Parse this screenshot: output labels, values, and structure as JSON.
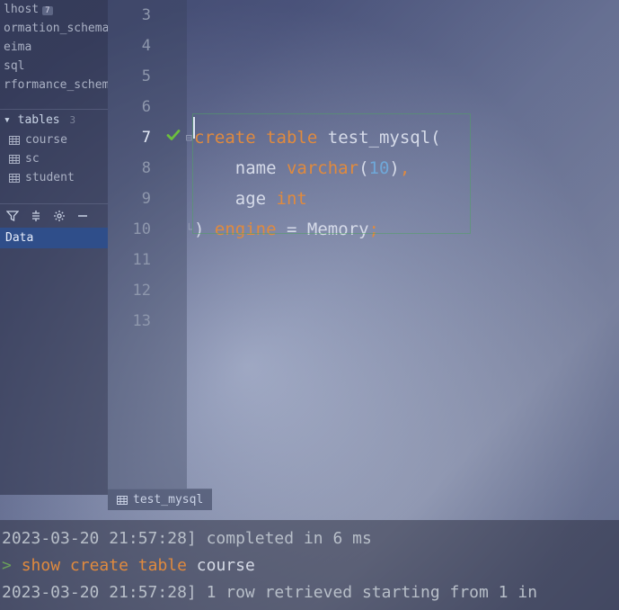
{
  "sidebar": {
    "databases": [
      {
        "name": "lhost",
        "badge": "7"
      },
      {
        "name": "ormation_schema",
        "badge": ""
      },
      {
        "name": "eima",
        "badge": ""
      },
      {
        "name": "sql",
        "badge": ""
      },
      {
        "name": "rformance_schem",
        "badge": ""
      }
    ],
    "tables_label": "tables",
    "tables_count": "3",
    "tables": [
      {
        "name": "course"
      },
      {
        "name": "sc"
      },
      {
        "name": "student"
      }
    ],
    "active_tab": "Data"
  },
  "editor": {
    "lines": [
      {
        "n": "3",
        "tokens": []
      },
      {
        "n": "4",
        "tokens": []
      },
      {
        "n": "5",
        "tokens": []
      },
      {
        "n": "6",
        "tokens": []
      },
      {
        "n": "7",
        "active": true,
        "check": true,
        "collapse_open": true,
        "tokens": [
          {
            "t": "create",
            "c": "kw"
          },
          {
            "t": " ",
            "c": ""
          },
          {
            "t": "table",
            "c": "kw"
          },
          {
            "t": " ",
            "c": ""
          },
          {
            "t": "test_mysql",
            "c": "ident"
          },
          {
            "t": "(",
            "c": "paren"
          }
        ]
      },
      {
        "n": "8",
        "tokens": [
          {
            "t": "    ",
            "c": ""
          },
          {
            "t": "name",
            "c": "ident"
          },
          {
            "t": " ",
            "c": ""
          },
          {
            "t": "varchar",
            "c": "type"
          },
          {
            "t": "(",
            "c": "paren"
          },
          {
            "t": "10",
            "c": "num"
          },
          {
            "t": ")",
            "c": "paren"
          },
          {
            "t": ",",
            "c": "punct"
          }
        ]
      },
      {
        "n": "9",
        "tokens": [
          {
            "t": "    ",
            "c": ""
          },
          {
            "t": "age",
            "c": "ident"
          },
          {
            "t": " ",
            "c": ""
          },
          {
            "t": "int",
            "c": "type"
          }
        ]
      },
      {
        "n": "10",
        "collapse_close": true,
        "tokens": [
          {
            "t": ")",
            "c": "paren"
          },
          {
            "t": " ",
            "c": ""
          },
          {
            "t": "engine",
            "c": "kw"
          },
          {
            "t": " ",
            "c": ""
          },
          {
            "t": "=",
            "c": "eq"
          },
          {
            "t": " ",
            "c": ""
          },
          {
            "t": "Memory",
            "c": "ident"
          },
          {
            "t": ";",
            "c": "punct"
          }
        ]
      },
      {
        "n": "11",
        "tokens": []
      },
      {
        "n": "12",
        "tokens": []
      },
      {
        "n": "13",
        "tokens": []
      }
    ],
    "tab_name": "test_mysql"
  },
  "console": {
    "line1_prefix": "2023-03-20 21:57:28] ",
    "line1_text": "completed in 6 ms",
    "line2_prompt": "> ",
    "line2_tokens": [
      {
        "t": "show",
        "c": "kw2"
      },
      {
        "t": " ",
        "c": ""
      },
      {
        "t": "create",
        "c": "kw2"
      },
      {
        "t": " ",
        "c": ""
      },
      {
        "t": "table",
        "c": "kw2"
      },
      {
        "t": " ",
        "c": ""
      },
      {
        "t": "course",
        "c": "ident2"
      }
    ],
    "line3": "2023-03-20 21:57:28] 1 row retrieved starting from 1 in"
  }
}
